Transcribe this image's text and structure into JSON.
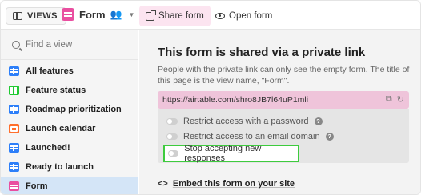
{
  "topbar": {
    "views_label": "VIEWS",
    "view_title": "Form",
    "tabs": [
      {
        "label": "Share form"
      },
      {
        "label": "Open form"
      }
    ]
  },
  "sidebar": {
    "search_placeholder": "Find a view",
    "items": [
      {
        "label": "All features",
        "icon": "grid-view-icon"
      },
      {
        "label": "Feature status",
        "icon": "kanban-view-icon"
      },
      {
        "label": "Roadmap prioritization",
        "icon": "grid-view-icon"
      },
      {
        "label": "Launch calendar",
        "icon": "calendar-view-icon"
      },
      {
        "label": "Launched!",
        "icon": "grid-view-icon"
      },
      {
        "label": "Ready to launch",
        "icon": "grid-view-icon"
      },
      {
        "label": "Form",
        "icon": "form-view-icon",
        "active": true
      }
    ]
  },
  "share": {
    "heading": "This form is shared via a private link",
    "description": "People with the private link can only see the empty form. The title of this page is the view name, \"Form\".",
    "link": "https://airtable.com/shro8JB7l64uP1mli",
    "options": [
      {
        "label": "Restrict access with a password",
        "enabled": false
      },
      {
        "label": "Restrict access to an email domain",
        "enabled": false
      },
      {
        "label": "Stop accepting new responses",
        "enabled": false
      }
    ],
    "embed_label": "Embed this form on your site"
  },
  "colors": {
    "accent_pink": "#e94fa0",
    "active_view_bg": "#d4e5f7",
    "highlight_border": "#3ecb3e"
  }
}
